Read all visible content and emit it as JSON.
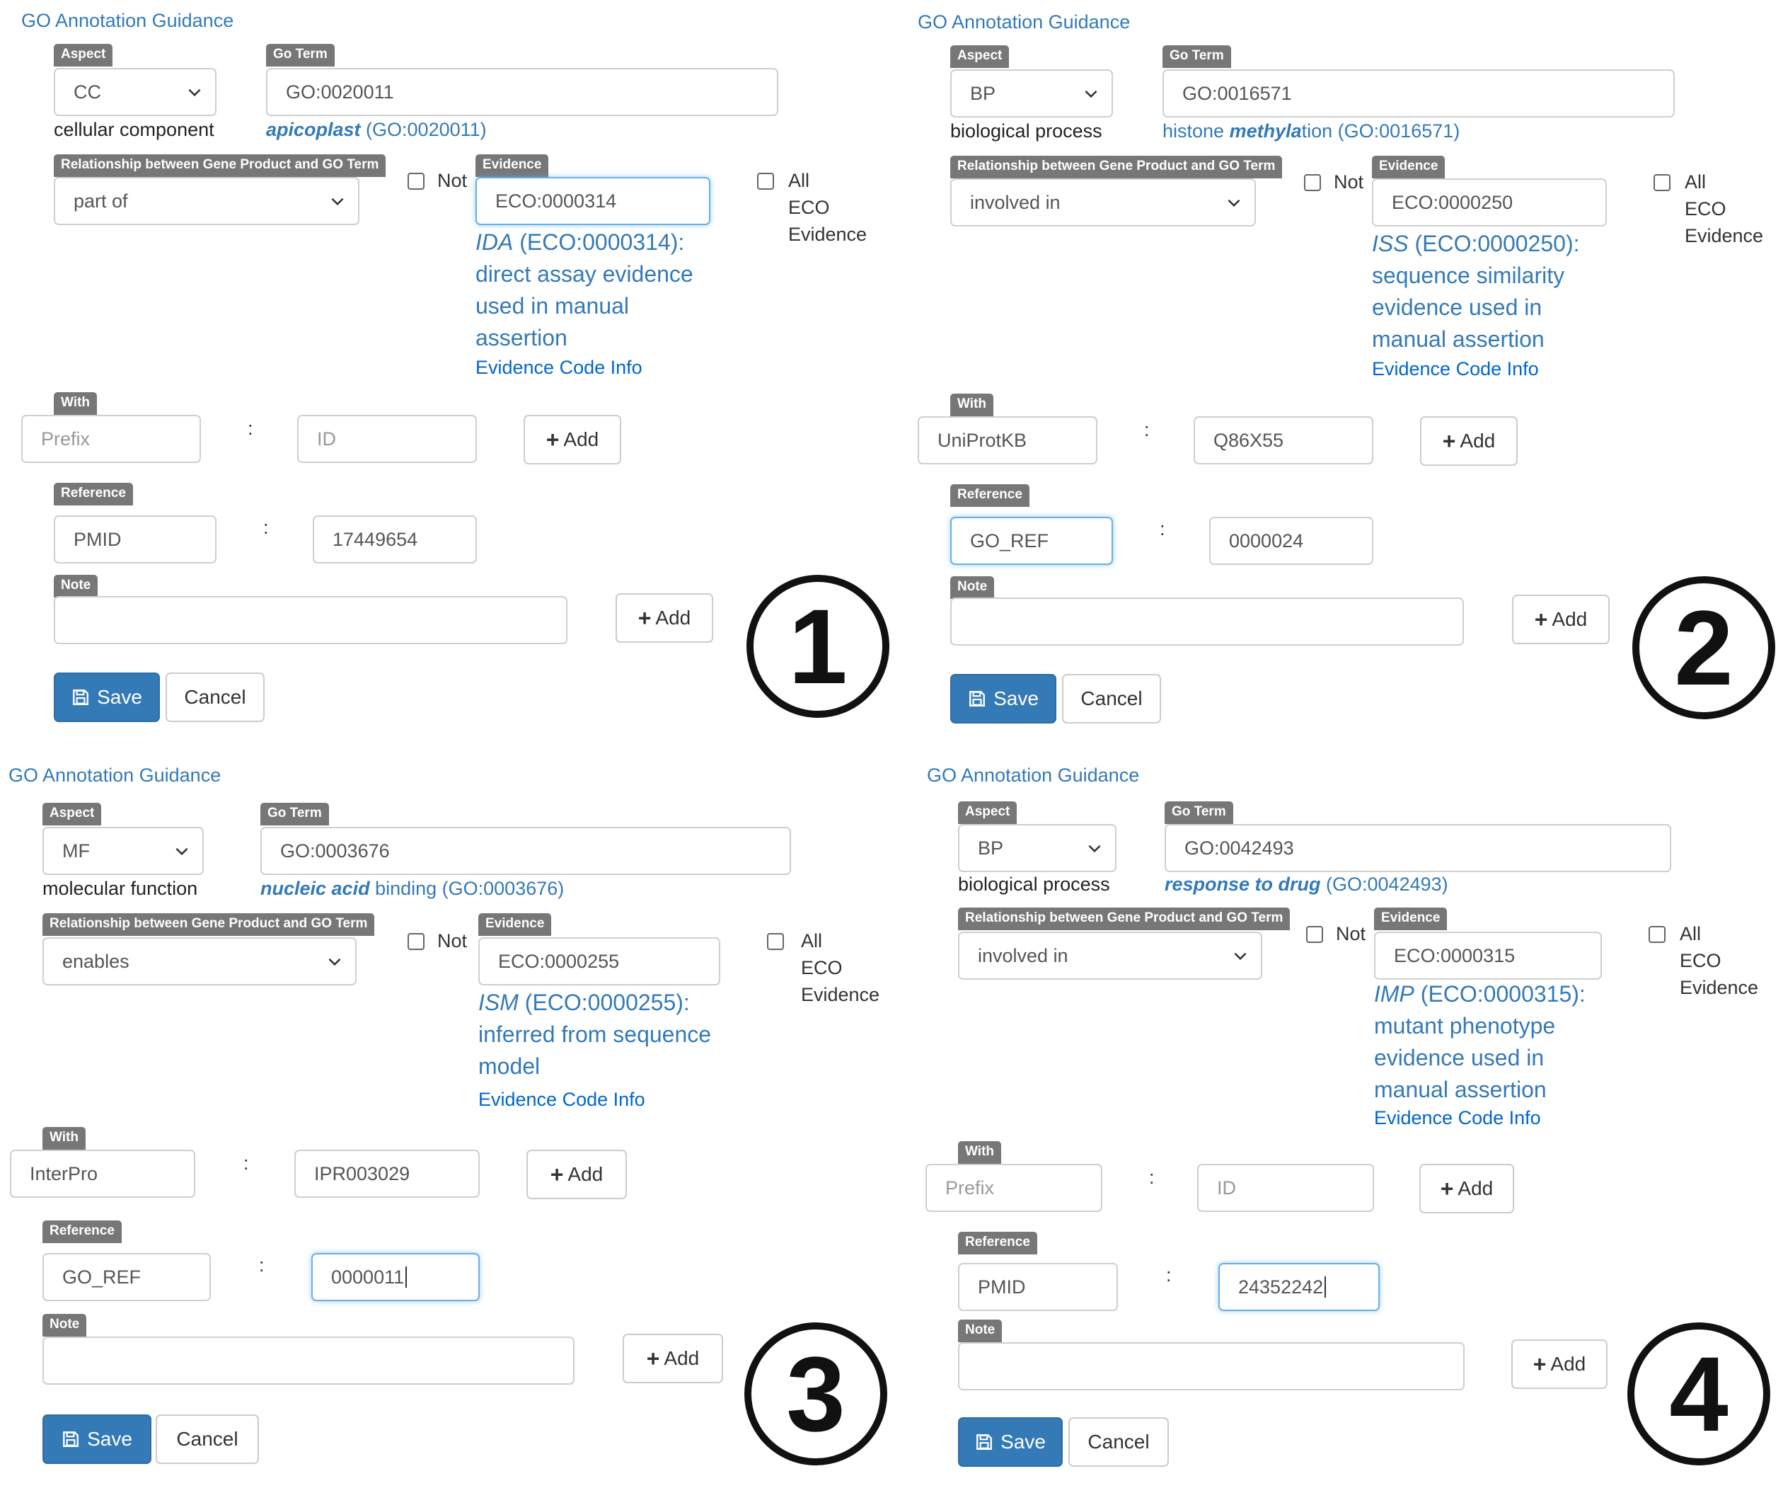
{
  "panels": [
    {
      "number": "1",
      "guidance_link": "GO Annotation Guidance",
      "aspect": {
        "label": "Aspect",
        "value": "CC",
        "description": "cellular component"
      },
      "go_term": {
        "label": "Go Term",
        "value": "GO:0020011",
        "display_bold": "apicoplast",
        "display_plain": " (GO:0020011)"
      },
      "relationship": {
        "label": "Relationship between Gene Product and GO Term",
        "value": "part of"
      },
      "not_label": "Not",
      "evidence": {
        "label": "Evidence",
        "value": "ECO:0000314",
        "abbr": "IDA",
        "desc_1": " (ECO:0000314):",
        "desc_2": "direct assay evidence",
        "desc_3": "used in manual",
        "desc_4": "assertion",
        "info_link": "Evidence Code Info"
      },
      "all_eco": {
        "line1": "All",
        "line2": "ECO",
        "line3": "Evidence"
      },
      "with": {
        "label": "With",
        "prefix": "",
        "prefix_placeholder": "Prefix",
        "id": "",
        "id_placeholder": "ID"
      },
      "reference": {
        "label": "Reference",
        "prefix": "PMID",
        "id": "17449654"
      },
      "note": {
        "label": "Note",
        "value": ""
      },
      "add_label": "Add",
      "save_label": "Save",
      "cancel_label": "Cancel"
    },
    {
      "number": "2",
      "guidance_link": "GO Annotation Guidance",
      "aspect": {
        "label": "Aspect",
        "value": "BP",
        "description": "biological process"
      },
      "go_term": {
        "label": "Go Term",
        "value": "GO:0016571",
        "display_pre": "histone ",
        "display_bold": "methyla",
        "display_plain": "tion (GO:0016571)"
      },
      "relationship": {
        "label": "Relationship between Gene Product and GO Term",
        "value": "involved in"
      },
      "not_label": "Not",
      "evidence": {
        "label": "Evidence",
        "value": "ECO:0000250",
        "abbr": "ISS",
        "desc_1": " (ECO:0000250):",
        "desc_2": "sequence similarity",
        "desc_3": "evidence used in",
        "desc_4": "manual assertion",
        "info_link": "Evidence Code Info"
      },
      "all_eco": {
        "line1": "All",
        "line2": "ECO",
        "line3": "Evidence"
      },
      "with": {
        "label": "With",
        "prefix": "UniProtKB",
        "prefix_placeholder": "Prefix",
        "id": "Q86X55",
        "id_placeholder": "ID"
      },
      "reference": {
        "label": "Reference",
        "prefix": "GO_REF",
        "id": "0000024"
      },
      "note": {
        "label": "Note",
        "value": ""
      },
      "add_label": "Add",
      "save_label": "Save",
      "cancel_label": "Cancel"
    },
    {
      "number": "3",
      "guidance_link": "GO Annotation Guidance",
      "aspect": {
        "label": "Aspect",
        "value": "MF",
        "description": "molecular function"
      },
      "go_term": {
        "label": "Go Term",
        "value": "GO:0003676",
        "display_bold": "nucleic acid",
        "display_plain": " binding (GO:0003676)"
      },
      "relationship": {
        "label": "Relationship between Gene Product and GO Term",
        "value": "enables"
      },
      "not_label": "Not",
      "evidence": {
        "label": "Evidence",
        "value": "ECO:0000255",
        "abbr": "ISM",
        "desc_1": " (ECO:0000255):",
        "desc_2": "inferred from sequence",
        "desc_3": "model",
        "info_link": "Evidence Code Info"
      },
      "all_eco": {
        "line1": "All",
        "line2": "ECO",
        "line3": "Evidence"
      },
      "with": {
        "label": "With",
        "prefix": "InterPro",
        "prefix_placeholder": "Prefix",
        "id": "IPR003029",
        "id_placeholder": "ID"
      },
      "reference": {
        "label": "Reference",
        "prefix": "GO_REF",
        "id": "0000011"
      },
      "note": {
        "label": "Note",
        "value": ""
      },
      "add_label": "Add",
      "save_label": "Save",
      "cancel_label": "Cancel"
    },
    {
      "number": "4",
      "guidance_link": "GO Annotation Guidance",
      "aspect": {
        "label": "Aspect",
        "value": "BP",
        "description": "biological process"
      },
      "go_term": {
        "label": "Go Term",
        "value": "GO:0042493",
        "display_bold": "response to drug",
        "display_plain": " (GO:0042493)"
      },
      "relationship": {
        "label": "Relationship between Gene Product and GO Term",
        "value": "involved in"
      },
      "not_label": "Not",
      "evidence": {
        "label": "Evidence",
        "value": "ECO:0000315",
        "abbr": "IMP",
        "desc_1": " (ECO:0000315):",
        "desc_2": "mutant phenotype",
        "desc_3": "evidence used in",
        "desc_4": "manual assertion",
        "info_link": "Evidence Code Info"
      },
      "all_eco": {
        "line1": "All",
        "line2": "ECO",
        "line3": "Evidence"
      },
      "with": {
        "label": "With",
        "prefix": "",
        "prefix_placeholder": "Prefix",
        "id": "",
        "id_placeholder": "ID"
      },
      "reference": {
        "label": "Reference",
        "prefix": "PMID",
        "id": "24352242"
      },
      "note": {
        "label": "Note",
        "value": ""
      },
      "add_label": "Add",
      "save_label": "Save",
      "cancel_label": "Cancel"
    }
  ]
}
